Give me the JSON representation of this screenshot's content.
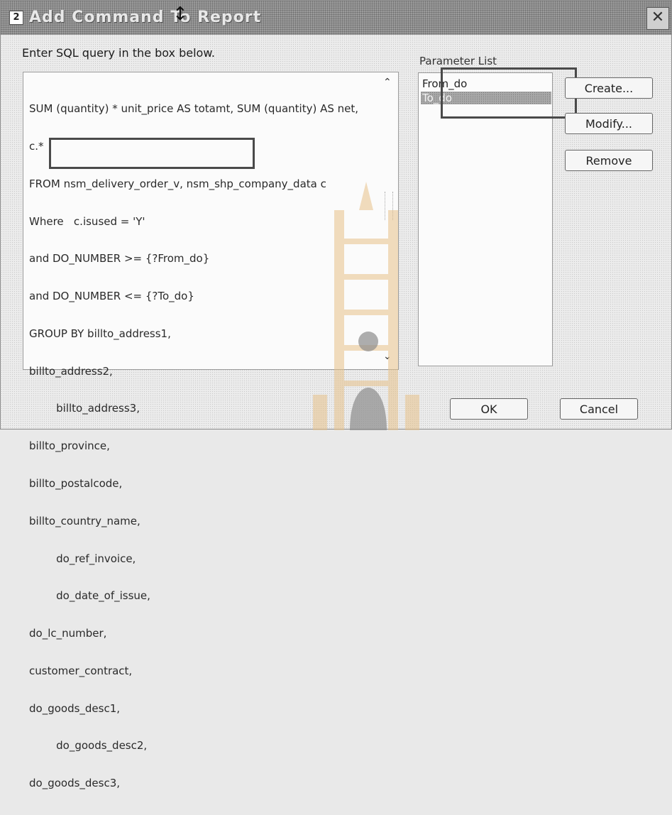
{
  "window": {
    "title": "Add Command To Report",
    "close_glyph": "✕",
    "icon_glyph": "2"
  },
  "prompt": "Enter SQL query in the box below.",
  "sql": {
    "lines": [
      "SUM (quantity) * unit_price AS totamt, SUM (quantity) AS net,",
      "c.*",
      "FROM nsm_delivery_order_v, nsm_shp_company_data c",
      "Where   c.isused = 'Y'",
      "and DO_NUMBER >= {?From_do}",
      "and DO_NUMBER <= {?To_do}",
      "GROUP BY billto_address1,",
      "billto_address2,",
      "        billto_address3,",
      "billto_province,",
      "billto_postalcode,",
      "billto_country_name,",
      "        do_ref_invoice,",
      "        do_date_of_issue,",
      "do_lc_number,",
      "customer_contract,",
      "do_goods_desc1,",
      "        do_goods_desc2,",
      "do_goods_desc3,"
    ]
  },
  "parameters": {
    "label": "Parameter List",
    "items": [
      {
        "label": "From_do",
        "selected": false
      },
      {
        "label": "To_do",
        "selected": true
      }
    ]
  },
  "buttons": {
    "create": "Create...",
    "modify": "Modify...",
    "remove": "Remove",
    "ok": "OK",
    "cancel": "Cancel"
  },
  "colors": {
    "highlight_border": "#4a4a4a",
    "selection": "#a8a8a8"
  }
}
